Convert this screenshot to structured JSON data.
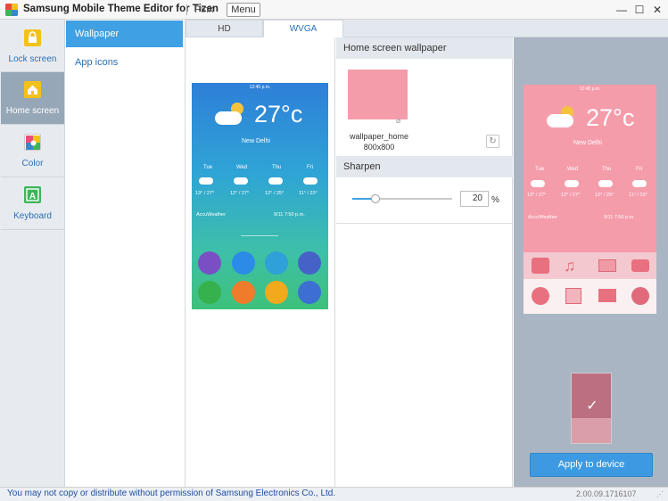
{
  "window": {
    "title": "Samsung Mobile Theme Editor for Tizen",
    "theme_name": "Pink",
    "menu_label": "Menu",
    "minimize": "—",
    "maximize": "☐",
    "close": "✕"
  },
  "nav": {
    "items": [
      {
        "label": "Lock screen",
        "icon": "lock-icon",
        "color": "#f2c21b"
      },
      {
        "label": "Home screen",
        "icon": "home-icon",
        "color": "#f2c21b"
      },
      {
        "label": "Color",
        "icon": "palette-icon",
        "color": "#e84f7a"
      },
      {
        "label": "Keyboard",
        "icon": "keyboard-a-icon",
        "color": "#3fb55a"
      }
    ],
    "active_index": 1
  },
  "submenu": {
    "items": [
      "Wallpaper",
      "App icons"
    ],
    "active_index": 0
  },
  "tabs": [
    "HD",
    "WVGA"
  ],
  "active_tab": "WVGA",
  "phone": {
    "time": "12:45 p.m.",
    "temperature": "27°c",
    "city": "New Delhi",
    "days": [
      {
        "day": "Tue",
        "temp": "13° / 27°"
      },
      {
        "day": "Wed",
        "temp": "12° / 27°"
      },
      {
        "day": "Thu",
        "temp": "12° / 25°"
      },
      {
        "day": "Fri",
        "temp": "11° / 23°"
      }
    ],
    "provider": "AccuWeather",
    "updated": "9/11  7:50 p.m."
  },
  "settings": {
    "wallpaper_header": "Home screen wallpaper",
    "wallpaper_name": "wallpaper_home",
    "wallpaper_size": "800x800",
    "sharpen_header": "Sharpen",
    "sharpen_value": "20",
    "sharpen_unit": "%",
    "sharpen_fraction": 0.2
  },
  "apply_button": "Apply to device",
  "status": {
    "copyright": "You may not copy or distribute without permission of Samsung Electronics Co., Ltd.",
    "version": "2.00.09.1716107"
  },
  "colors": {
    "accent": "#3fa0e3",
    "wallpaper": "#f59cab",
    "nav_active": "#96a7b8"
  }
}
